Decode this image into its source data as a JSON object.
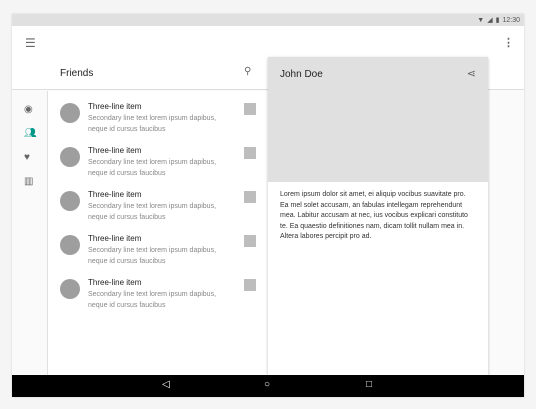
{
  "status": {
    "time": "12:30",
    "icons": [
      "wifi-icon",
      "signal-icon",
      "battery-icon"
    ]
  },
  "appbar": {
    "title": "Friends"
  },
  "rail": {
    "items": [
      "explore-icon",
      "people-icon",
      "favorite-icon",
      "map-icon"
    ],
    "active": "people-icon",
    "accent": "#009688"
  },
  "list": {
    "items": [
      {
        "primary": "Three-line item",
        "secondary": "Secondary line text lorem ipsum dapibus, neque id cursus faucibus"
      },
      {
        "primary": "Three-line item",
        "secondary": "Secondary line text lorem ipsum dapibus, neque id cursus faucibus"
      },
      {
        "primary": "Three-line item",
        "secondary": "Secondary line text lorem ipsum dapibus, neque id cursus faucibus"
      },
      {
        "primary": "Three-line item",
        "secondary": "Secondary line text lorem ipsum dapibus, neque id cursus faucibus"
      },
      {
        "primary": "Three-line item",
        "secondary": "Secondary line text lorem ipsum dapibus, neque id cursus faucibus"
      }
    ]
  },
  "detail": {
    "title": "John Doe",
    "body": "Lorem ipsum dolor sit amet, ei aliquip vocibus suavitate pro. Ea mel solet accusam, an fabulas intellegam reprehendunt mea. Labitur accusam at nec, ius vocibus explicari constituto te. Ea quaestio definitiones nam, dicam tollit nullam mea in. Altera labores percipit pro ad."
  }
}
